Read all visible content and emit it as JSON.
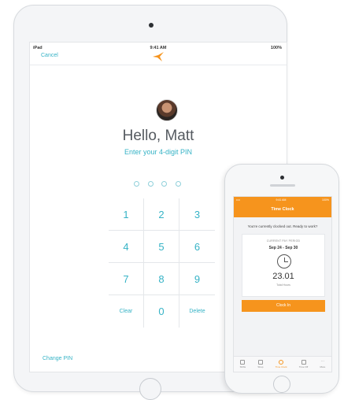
{
  "ipad": {
    "status": {
      "left": "iPad",
      "time": "9:41 AM",
      "battery": "100%"
    },
    "nav": {
      "cancel": "Cancel"
    },
    "greeting": "Hello, Matt",
    "prompt": "Enter your 4-digit PIN",
    "keypad": {
      "k1": "1",
      "k2": "2",
      "k3": "3",
      "k4": "4",
      "k5": "5",
      "k6": "6",
      "k7": "7",
      "k8": "8",
      "k9": "9",
      "clear": "Clear",
      "k0": "0",
      "delete": "Delete"
    },
    "change_pin": "Change PIN",
    "accent": "#36b3c6"
  },
  "iphone": {
    "status": {
      "left": "••••",
      "time": "9:41 AM",
      "battery": "100%"
    },
    "title": "Time Clock",
    "message": "You're currently clocked out. Ready to work?",
    "card": {
      "label": "CURRENT PAY PERIOD",
      "range": "Sep 24 - Sep 30",
      "hours": "23.01",
      "hours_label": "Total Hours"
    },
    "clock_in": "Clock In",
    "tabs": [
      {
        "label": "Shifts"
      },
      {
        "label": "Shop"
      },
      {
        "label": "Time Clock"
      },
      {
        "label": "Time Off"
      },
      {
        "label": "More"
      }
    ],
    "accent": "#f6941d"
  }
}
